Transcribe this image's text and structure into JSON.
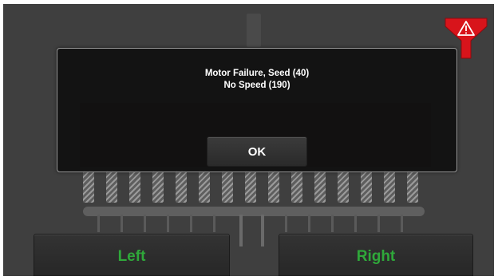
{
  "dialog": {
    "message_line1": "Motor Failure, Seed (40)",
    "message_line2": "No Speed (190)",
    "ok_label": "OK"
  },
  "buttons": {
    "left_label": "Left",
    "right_label": "Right"
  },
  "alarm": {
    "icon": "funnel-warning-icon",
    "color": "#d8141b",
    "symbol": "⚠"
  },
  "colors": {
    "side_label": "#2fa83a",
    "background": "#3f3f3f"
  }
}
